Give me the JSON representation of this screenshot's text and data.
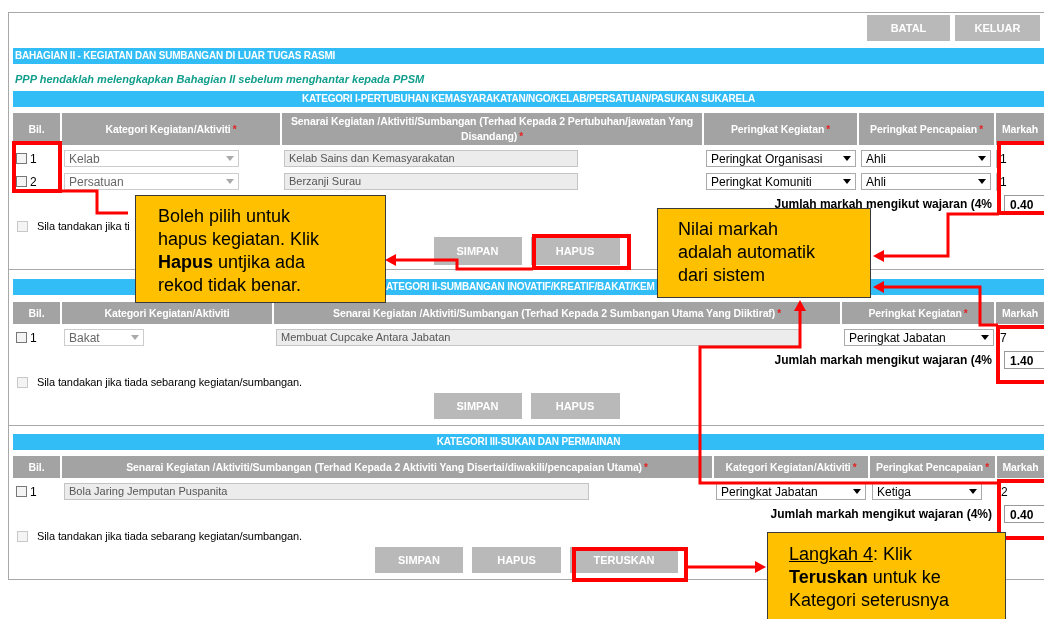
{
  "top_buttons": [
    "BATAL",
    "KELUAR"
  ],
  "part_title": "BAHAGIAN II - KEGIATAN DAN SUMBANGAN DI LUAR TUGAS RASMI",
  "notice": "PPP hendaklah melengkapkan Bahagian II sebelum menghantar kepada PPSM",
  "sections": [
    {
      "title": "KATEGORI I-PERTUBUHAN KEMASYARAKATAN/NGO/KELAB/PERSATUAN/PASUKAN SUKARELA",
      "columns": [
        {
          "label": "Bil."
        },
        {
          "label": "Kategori Kegiatan/Aktiviti",
          "mark": "*"
        },
        {
          "label": "Senarai Kegiatan /Aktiviti/Sumbangan (Terhad Kepada 2 Pertubuhan/jawatan Yang Disandang)",
          "mark": "*"
        },
        {
          "label": "Peringkat Kegiatan",
          "mark": "*"
        },
        {
          "label": "Peringkat Pencapaian",
          "mark": "*"
        },
        {
          "label": "Markah"
        }
      ],
      "rows": [
        {
          "cells": [
            {
              "kind": "number",
              "value": "1",
              "checked": false
            },
            {
              "kind": "select",
              "value": "Kelab",
              "disabled": true
            },
            {
              "kind": "text",
              "value": "Kelab Sains dan Kemasyarakatan",
              "disabled": true
            },
            {
              "kind": "select",
              "value": "Peringkat Organisasi",
              "disabled": false
            },
            {
              "kind": "select",
              "value": "Ahli",
              "disabled": false
            },
            {
              "kind": "input",
              "value": "1"
            }
          ]
        },
        {
          "cells": [
            {
              "kind": "number",
              "value": "2",
              "checked": false
            },
            {
              "kind": "select",
              "value": "Persatuan",
              "disabled": true
            },
            {
              "kind": "text",
              "value": "Berzanji Surau",
              "disabled": true
            },
            {
              "kind": "select",
              "value": "Peringkat Komuniti",
              "disabled": false
            },
            {
              "kind": "select",
              "value": "Ahli",
              "disabled": false
            },
            {
              "kind": "input",
              "value": "1"
            }
          ]
        }
      ],
      "total_label": "Jumlah markah mengikut wajaran (4%",
      "total": "0.40",
      "none_option": {
        "label": "Sila tandakan jika ti",
        "checked": false
      },
      "buttons": [
        "SIMPAN",
        "HAPUS"
      ]
    },
    {
      "title": "ATEGORI II-SUMBANGAN INOVATIF/KREATIF/BAKAT/KEM",
      "columns": [
        {
          "label": "Bil."
        },
        {
          "label": "Kategori Kegiatan/Aktiviti"
        },
        {
          "label": "Senarai Kegiatan /Aktiviti/Sumbangan (Terhad Kepada 2 Sumbangan Utama Yang Diiktiraf)",
          "mark": "*"
        },
        {
          "label": "Peringkat Kegiatan",
          "mark": "*"
        },
        {
          "label": "Markah"
        }
      ],
      "rows": [
        {
          "cells": [
            {
              "kind": "number",
              "value": "1",
              "checked": false
            },
            {
              "kind": "select",
              "value": "Bakat",
              "disabled": true
            },
            {
              "kind": "text",
              "value": "Membuat Cupcake Antara Jabatan",
              "disabled": true
            },
            {
              "kind": "select",
              "value": "Peringkat Jabatan",
              "disabled": false
            },
            {
              "kind": "input",
              "value": "7"
            }
          ]
        }
      ],
      "total_label": "Jumlah markah mengikut wajaran (4%",
      "total": "1.40",
      "none_option": {
        "label": "Sila tandakan jika tiada sebarang kegiatan/sumbangan.",
        "checked": false
      },
      "buttons": [
        "SIMPAN",
        "HAPUS"
      ]
    },
    {
      "title": "KATEGORI III-SUKAN DAN PERMAINAN",
      "columns": [
        {
          "label": "Bil."
        },
        {
          "label": "Senarai Kegiatan /Aktiviti/Sumbangan (Terhad Kepada 2 Aktiviti Yang Disertai/diwakili/pencapaian Utama)",
          "mark": "*"
        },
        {
          "label": "Kategori Kegiatan/Aktiviti",
          "mark": "*"
        },
        {
          "label": "Peringkat Pencapaian",
          "mark": "*"
        },
        {
          "label": "Markah"
        }
      ],
      "rows": [
        {
          "cells": [
            {
              "kind": "number",
              "value": "1",
              "checked": false
            },
            {
              "kind": "text",
              "value": "Bola Jaring Jemputan Puspanita",
              "disabled": true
            },
            {
              "kind": "select",
              "value": "Peringkat Jabatan",
              "disabled": false
            },
            {
              "kind": "select",
              "value": "Ketiga",
              "disabled": false
            },
            {
              "kind": "input",
              "value": "2"
            }
          ]
        }
      ],
      "total_label": "Jumlah markah mengikut wajaran (4%)",
      "total": "0.40",
      "none_option": {
        "label": "Sila tandakan jika tiada sebarang kegiatan/sumbangan.",
        "checked": false
      },
      "buttons": [
        "SIMPAN",
        "HAPUS",
        "TERUSKAN"
      ]
    }
  ],
  "callouts": [
    {
      "text": "Boleh pilih untuk hapus kegiatan. Klik **Hapus** untjika ada rekod tidak benar."
    },
    {
      "text": "Nilai markah adalah automatik dari sistem"
    },
    {
      "step": "Langkah 4",
      "text": ": Klik **Teruskan** untuk ke Kategori seterusnya"
    }
  ]
}
